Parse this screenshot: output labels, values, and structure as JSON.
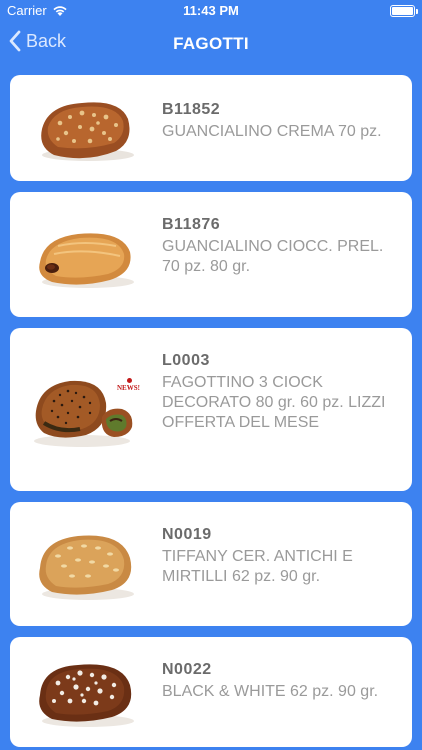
{
  "status_bar": {
    "carrier": "Carrier",
    "time": "11:43 PM"
  },
  "nav": {
    "back_label": "Back",
    "title": "FAGOTTI"
  },
  "products": [
    {
      "code": "B11852",
      "description": "GUANCIALINO CREMA 70 pz."
    },
    {
      "code": "B11876",
      "description": "GUANCIALINO CIOCC. PREL. 70 pz. 80 gr."
    },
    {
      "code": "L0003",
      "description": "FAGOTTINO 3 CIOCK DECORATO 80 gr. 60 pz. LIZZI OFFERTA DEL MESE",
      "badge": "NEWS!"
    },
    {
      "code": "N0019",
      "description": "TIFFANY CER. ANTICHI E MIRTILLI 62 pz. 90 gr."
    },
    {
      "code": "N0022",
      "description": "BLACK & WHITE 62 pz. 90 gr."
    }
  ],
  "colors": {
    "background": "#3d82f0",
    "card": "#ffffff",
    "code_text": "#6b6b6b",
    "description_text": "#9a9a9a"
  }
}
